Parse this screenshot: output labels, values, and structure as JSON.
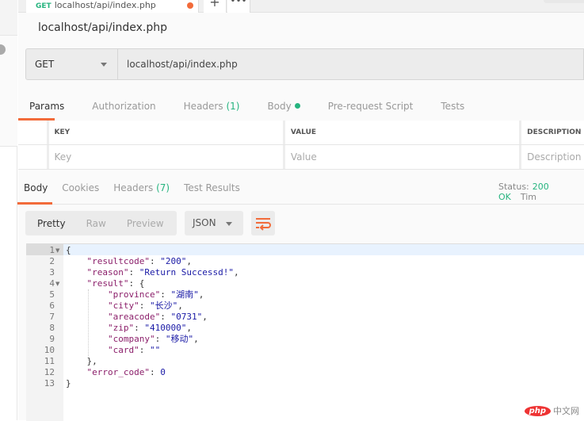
{
  "tab": {
    "method": "GET",
    "title": "localhost/api/index.php",
    "dirty_color": "#f26b3a"
  },
  "tab_actions": {
    "new": "+",
    "more": "•••"
  },
  "request": {
    "title": "localhost/api/index.php",
    "method": "GET",
    "url": "localhost/api/index.php"
  },
  "request_tabs": [
    {
      "label": "Params"
    },
    {
      "label": "Authorization"
    },
    {
      "label": "Headers",
      "count": "(1)"
    },
    {
      "label": "Body"
    },
    {
      "label": "Pre-request Script"
    },
    {
      "label": "Tests"
    }
  ],
  "params_table": {
    "headers": [
      "KEY",
      "VALUE",
      "DESCRIPTION"
    ],
    "placeholders": [
      "Key",
      "Value",
      "Description"
    ]
  },
  "response_tabs": [
    {
      "label": "Body"
    },
    {
      "label": "Cookies"
    },
    {
      "label": "Headers",
      "count": "(7)"
    },
    {
      "label": "Test Results"
    }
  ],
  "status": {
    "label": "Status:",
    "value": "200 OK",
    "time_label": "Tim"
  },
  "format": {
    "modes": [
      "Pretty",
      "Raw",
      "Preview"
    ],
    "language": "JSON"
  },
  "code_lines": [
    "{",
    "    \"resultcode\": \"200\",",
    "    \"reason\": \"Return Successd!\",",
    "    \"result\": {",
    "        \"province\": \"湖南\",",
    "        \"city\": \"长沙\",",
    "        \"areacode\": \"0731\",",
    "        \"zip\": \"410000\",",
    "        \"company\": \"移动\",",
    "        \"card\": \"\"",
    "    },",
    "    \"error_code\": 0",
    "}"
  ],
  "watermark": {
    "logo": "php",
    "text": "中文网"
  },
  "colors": {
    "accent": "#f26b3a",
    "success": "#26b47f",
    "json_key": "#8b1e6a",
    "json_string": "#1a1aa6"
  }
}
